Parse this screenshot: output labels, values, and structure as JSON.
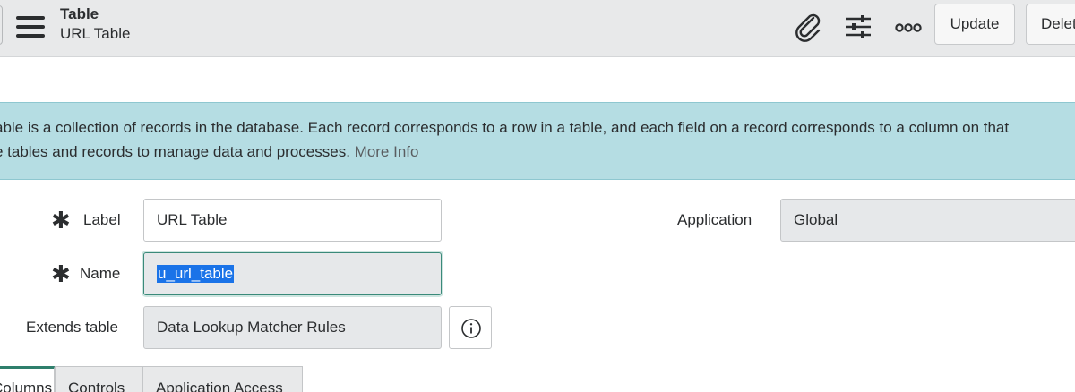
{
  "header": {
    "record_type": "Table",
    "record_name": "URL Table",
    "icons": [
      "menu-icon",
      "paperclip-icon",
      "sliders-icon",
      "more-icon"
    ],
    "buttons": {
      "update": "Update",
      "delete": "Delete"
    }
  },
  "banner": {
    "line1": "able is a collection of records in the database. Each record corresponds to a row in a table, and each field on a record corresponds to a column on that",
    "line2": "e tables and records to manage data and processes.",
    "more_info": "More Info",
    "color": "#b5dde3"
  },
  "form": {
    "label": {
      "label": "Label",
      "value": "URL Table",
      "required": true
    },
    "name": {
      "label": "Name",
      "value": "u_url_table",
      "required": true
    },
    "extends_table": {
      "label": "Extends table",
      "value": "Data Lookup Matcher Rules"
    },
    "application": {
      "label": "Application",
      "value": "Global"
    },
    "required_mark": "✱"
  },
  "tabs": [
    {
      "label": "Columns",
      "active": true
    },
    {
      "label": "Controls",
      "active": false
    },
    {
      "label": "Application Access",
      "active": false
    }
  ],
  "colors": {
    "accent": "#2f7f6c",
    "selection": "#1a73e8"
  }
}
